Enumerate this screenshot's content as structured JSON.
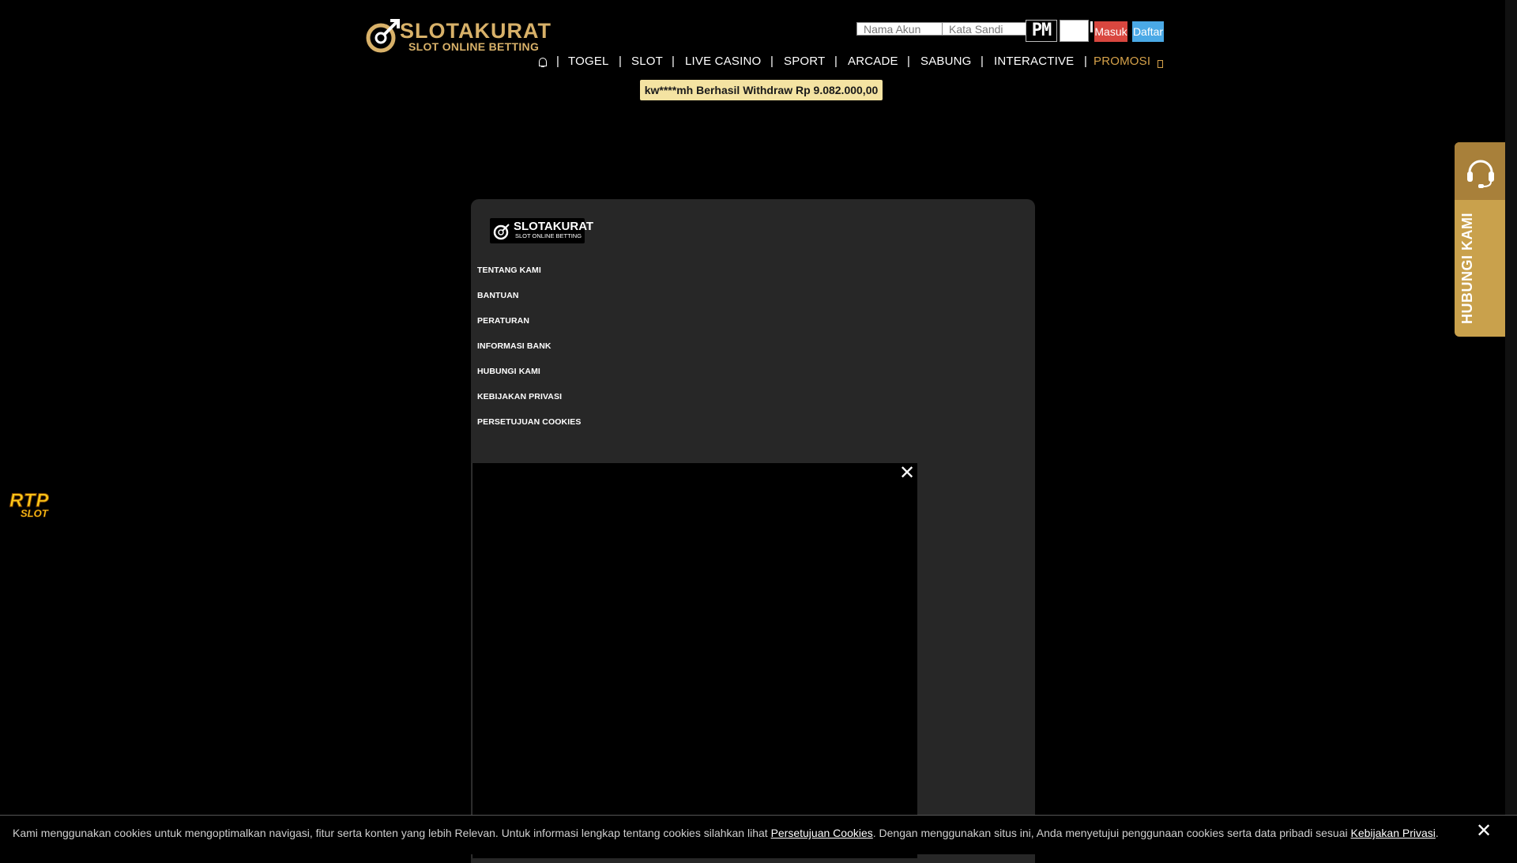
{
  "brand": {
    "name": "SLOTAKURAT",
    "tagline": "SLOT ONLINE BETTING"
  },
  "login": {
    "username_placeholder": "Nama Akun",
    "password_placeholder": "Kata Sandi",
    "captcha_text": "PM",
    "login_label": "Masuk",
    "register_label": "Daftar"
  },
  "nav": {
    "items": [
      "TOGEL",
      "SLOT",
      "LIVE CASINO",
      "SPORT",
      "ARCADE",
      "SABUNG",
      "INTERACTIVE",
      "PROMOSI"
    ],
    "separator": "|"
  },
  "ticker": {
    "text": "kw****mh Berhasil Withdraw Rp 9.082.000,00"
  },
  "footer": {
    "links": [
      "TENTANG KAMI",
      "BANTUAN",
      "PERATURAN",
      "INFORMASI BANK",
      "HUBUNGI KAMI",
      "KEBIJAKAN PRIVASI",
      "PERSETUJUAN COOKIES"
    ]
  },
  "popup": {
    "close_icon": "close-icon"
  },
  "contact_tab": {
    "label": "HUBUNGI KAMI",
    "icon": "headset-icon"
  },
  "rtp_badge": {
    "top": "RTP",
    "bottom": "SLOT"
  },
  "cookie_bar": {
    "text_before": "Kami menggunakan cookies untuk mengoptimalkan navigasi, fitur serta konten yang lebih Relevan. Untuk informasi lengkap tentang cookies silahkan lihat ",
    "link1": "Persetujuan Cookies",
    "text_middle": ". Dengan menggunakan situs ini, Anda menyetujui penggunaan cookies serta data pribadi sesuai ",
    "link2": "Kebijakan Privasi",
    "text_after": "."
  },
  "colors": {
    "brand_gold": "#d8b169",
    "login_red": "#d9473f",
    "register_blue": "#4aa9e6",
    "ticker_bg": "#f4e3a2",
    "panel_bg": "#272727",
    "contact_gold": "#c9a14c",
    "promo_text": "#d6a24a"
  }
}
